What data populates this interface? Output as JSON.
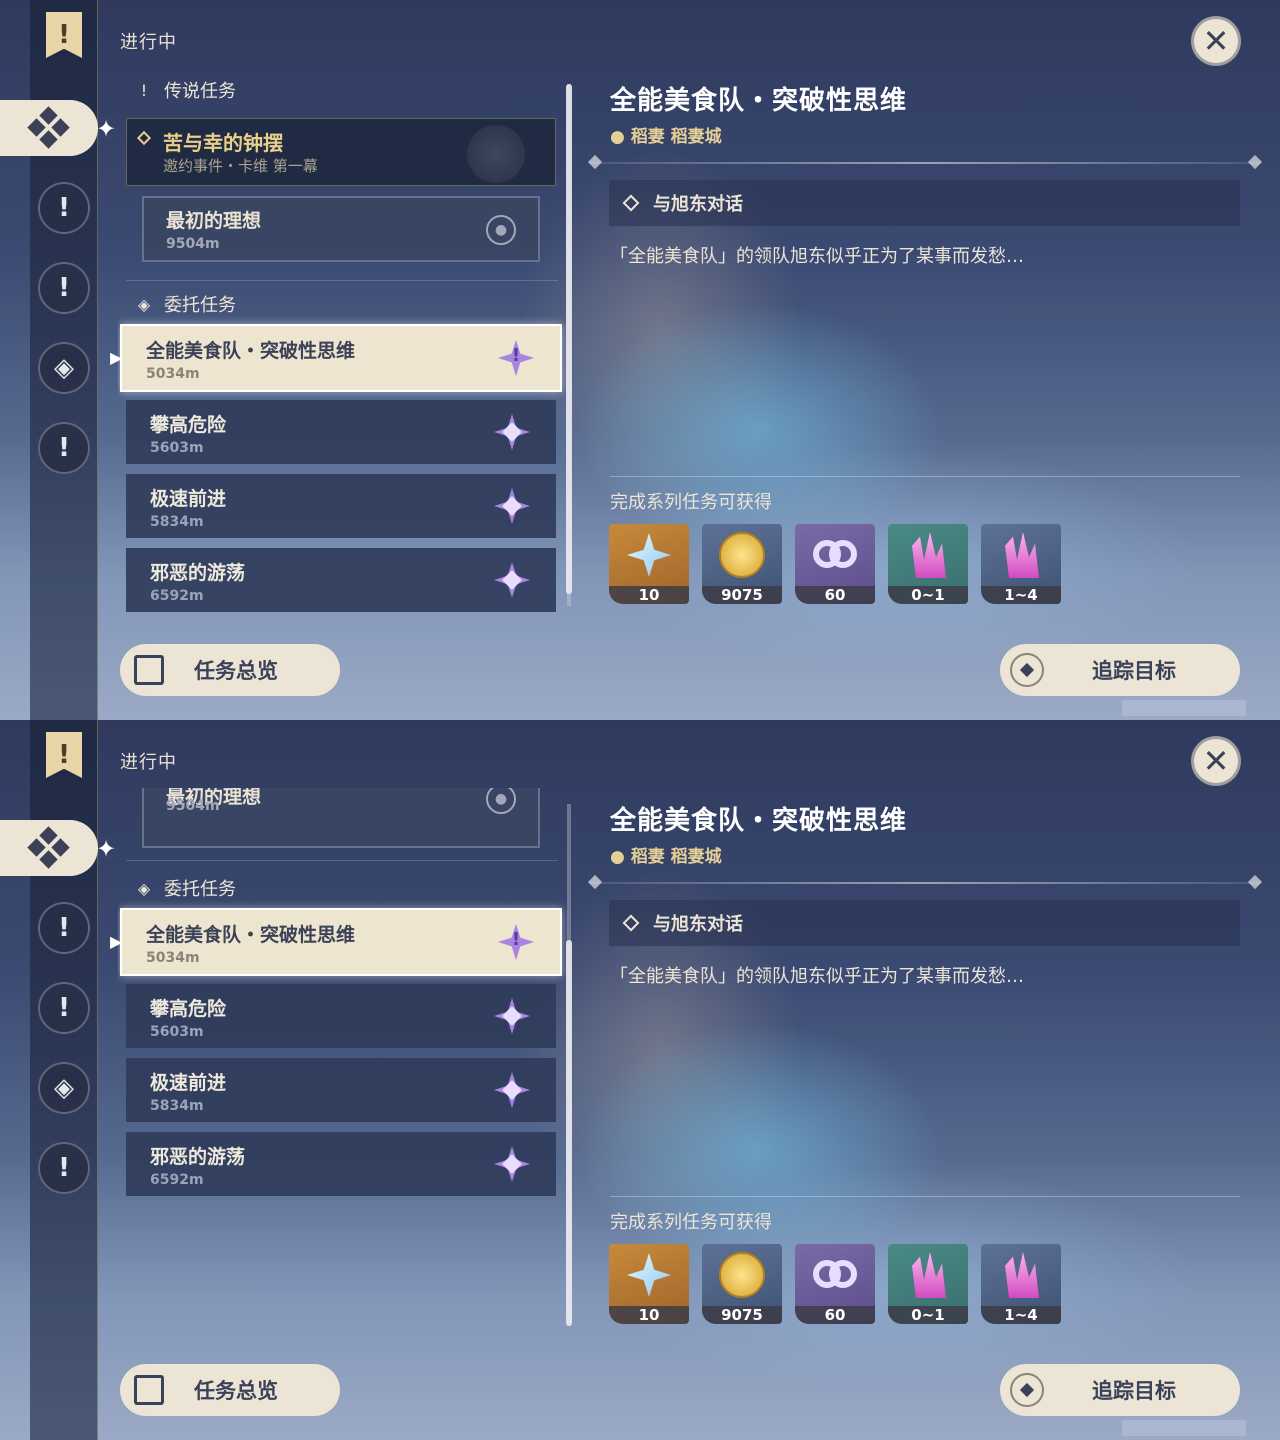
{
  "status_label": "进行中",
  "close_icon": "✕",
  "legend_section": "传说任务",
  "commission_section": "委托任务",
  "legend_quest": {
    "title": "苦与幸的钟摆",
    "subtitle": "邀约事件・卡维 第一幕"
  },
  "legend_subquest": {
    "title": "最初的理想",
    "distance": "9504m"
  },
  "quests": [
    {
      "title": "全能美食队・突破性思维",
      "distance": "5034m",
      "selected": true
    },
    {
      "title": "攀高危险",
      "distance": "5603m",
      "selected": false
    },
    {
      "title": "极速前进",
      "distance": "5834m",
      "selected": false
    },
    {
      "title": "邪恶的游荡",
      "distance": "6592m",
      "selected": false
    }
  ],
  "detail": {
    "title": "全能美食队・突破性思维",
    "location": "稻妻 稻妻城",
    "objective": "与旭东对话",
    "description": "「全能美食队」的领队旭东似乎正为了某事而发愁…",
    "rewards_label": "完成系列任务可获得",
    "rewards": [
      {
        "icon": "primogem-icon",
        "count": "10"
      },
      {
        "icon": "mora-icon",
        "count": "9075"
      },
      {
        "icon": "companionship-exp-icon",
        "count": "60"
      },
      {
        "icon": "ore-crystal-icon",
        "count": "0~1"
      },
      {
        "icon": "enhancement-crystal-icon",
        "count": "1~4"
      }
    ]
  },
  "buttons": {
    "overview": "任务总览",
    "track": "追踪目标"
  },
  "icon_glyphs": {
    "exclaim": "!",
    "pin": "●",
    "sparkle": "✦",
    "arrow": "▶"
  }
}
